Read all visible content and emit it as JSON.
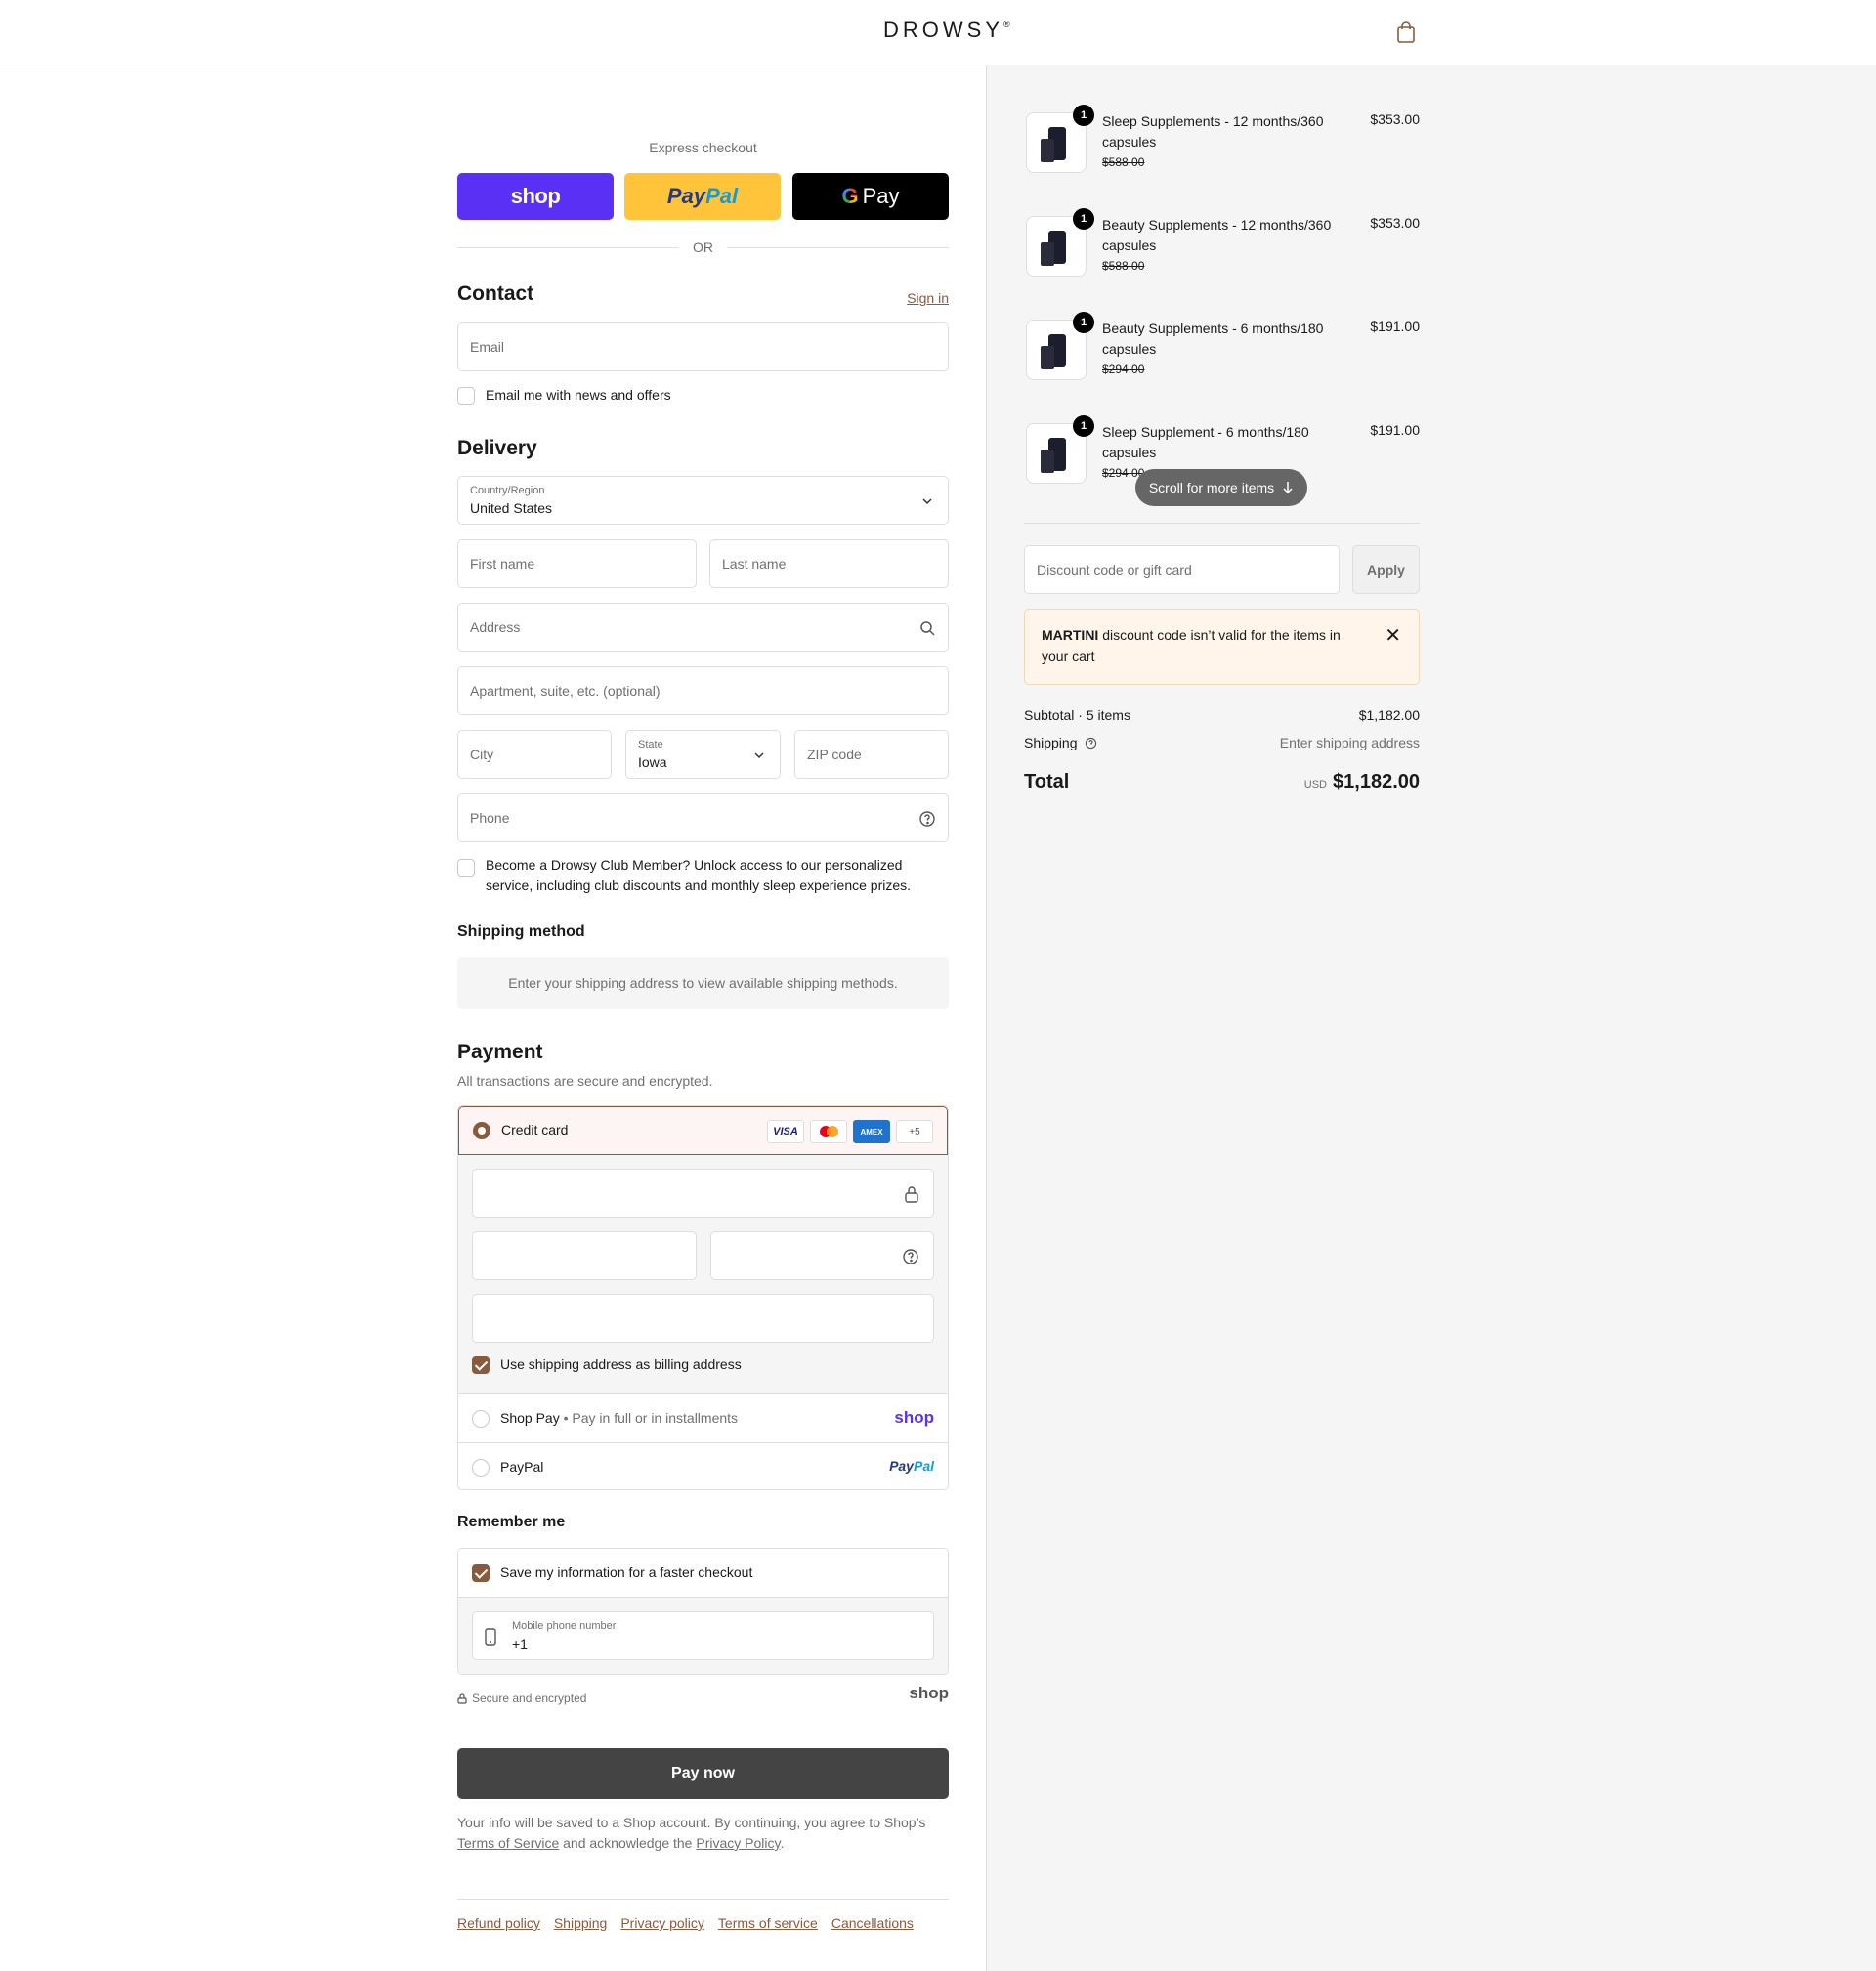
{
  "header": {
    "brand": "DROWSY",
    "brand_mark": "®"
  },
  "express": {
    "title": "Express checkout",
    "shop_label": "shop",
    "paypal_a": "Pay",
    "paypal_b": "Pal",
    "gpay_label": "Pay",
    "or_label": "OR"
  },
  "contact": {
    "title": "Contact",
    "sign_in": "Sign in",
    "email_placeholder": "Email",
    "news_label": "Email me with news and offers"
  },
  "delivery": {
    "title": "Delivery",
    "country_label": "Country/Region",
    "country_value": "United States",
    "first_name": "First name",
    "last_name": "Last name",
    "address": "Address",
    "apartment": "Apartment, suite, etc. (optional)",
    "city": "City",
    "state_label": "State",
    "state_value": "Iowa",
    "zip": "ZIP code",
    "phone": "Phone",
    "club_label": "Become a Drowsy Club Member? Unlock access to our personalized service, including club discounts and monthly sleep experience prizes."
  },
  "shipping_method": {
    "title": "Shipping method",
    "info": "Enter your shipping address to view available shipping methods."
  },
  "payment": {
    "title": "Payment",
    "subtitle": "All transactions are secure and encrypted.",
    "credit_card": "Credit card",
    "card_visa": "VISA",
    "card_amex": "AMEX",
    "card_more": "+5",
    "billing_label": "Use shipping address as billing address",
    "shop_pay": "Shop Pay",
    "shop_pay_sub": "Pay in full or in installments",
    "shop_pay_logo": "shop",
    "paypal": "PayPal",
    "paypal_logo_a": "Pay",
    "paypal_logo_b": "Pal"
  },
  "remember": {
    "title": "Remember me",
    "save_label": "Save my information for a faster checkout",
    "mobile_label": "Mobile phone number",
    "mobile_value": "+1",
    "secure": "Secure and encrypted",
    "shop_logo": "shop"
  },
  "pay_now": "Pay now",
  "legal": {
    "text1": "Your info will be saved to a Shop account. By continuing, you agree to Shop’s ",
    "tos": "Terms of Service",
    "text2": " and acknowledge the ",
    "privacy": "Privacy Policy",
    "text3": "."
  },
  "footer": {
    "links": [
      "Refund policy",
      "Shipping",
      "Privacy policy",
      "Terms of service",
      "Cancellations"
    ]
  },
  "cart": {
    "items": [
      {
        "qty": "1",
        "name": "Sleep Supplements - 12 months/360 capsules",
        "old_price": "$588.00",
        "price": "$353.00"
      },
      {
        "qty": "1",
        "name": "Beauty Supplements - 12 months/360 capsules",
        "old_price": "$588.00",
        "price": "$353.00"
      },
      {
        "qty": "1",
        "name": "Beauty Supplements - 6 months/180 capsules",
        "old_price": "$294.00",
        "price": "$191.00"
      },
      {
        "qty": "1",
        "name": "Sleep Supplement - 6 months/180 capsules",
        "old_price": "$294.00",
        "price": "$191.00"
      }
    ],
    "scroll_hint": "Scroll for more items",
    "discount_placeholder": "Discount code or gift card",
    "apply": "Apply",
    "alert_code": "MARTINI",
    "alert_text": " discount code isn’t valid for the items in your cart",
    "subtotal_label": "Subtotal · 5 items",
    "subtotal_value": "$1,182.00",
    "shipping_label": "Shipping",
    "shipping_value": "Enter shipping address",
    "total_label": "Total",
    "currency": "USD",
    "total_value": "$1,182.00"
  }
}
